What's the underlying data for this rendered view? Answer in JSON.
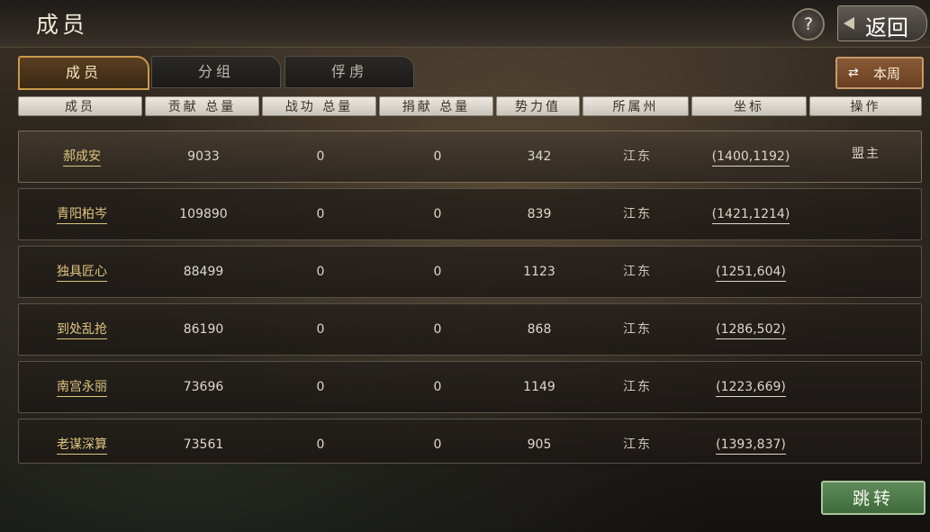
{
  "header": {
    "title": "成员",
    "help_icon_text": "?",
    "back_label": "返回"
  },
  "tabs": [
    {
      "label": "成员",
      "active": true
    },
    {
      "label": "分组",
      "active": false
    },
    {
      "label": "俘虏",
      "active": false
    }
  ],
  "period_toggle": {
    "label": "本周",
    "icon": "swap-arrows-icon"
  },
  "columns": [
    "成员",
    "贡献 总量",
    "战功 总量",
    "捐献 总量",
    "势力值",
    "所属州",
    "坐标",
    "操作"
  ],
  "rows": [
    {
      "name": "郝成安",
      "contribution": "9033",
      "merit": "0",
      "donation": "0",
      "power": "342",
      "state": "江东",
      "coord": "(1400,1192)",
      "op": "盟主"
    },
    {
      "name": "青阳柏岑",
      "contribution": "109890",
      "merit": "0",
      "donation": "0",
      "power": "839",
      "state": "江东",
      "coord": "(1421,1214)",
      "op": ""
    },
    {
      "name": "独具匠心",
      "contribution": "88499",
      "merit": "0",
      "donation": "0",
      "power": "1123",
      "state": "江东",
      "coord": "(1251,604)",
      "op": ""
    },
    {
      "name": "到处乱抢",
      "contribution": "86190",
      "merit": "0",
      "donation": "0",
      "power": "868",
      "state": "江东",
      "coord": "(1286,502)",
      "op": ""
    },
    {
      "name": "南宫永丽",
      "contribution": "73696",
      "merit": "0",
      "donation": "0",
      "power": "1149",
      "state": "江东",
      "coord": "(1223,669)",
      "op": ""
    },
    {
      "name": "老谋深算",
      "contribution": "73561",
      "merit": "0",
      "donation": "0",
      "power": "905",
      "state": "江东",
      "coord": "(1393,837)",
      "op": ""
    }
  ],
  "footer": {
    "jump_label": "跳转"
  },
  "colors": {
    "accent_gold": "#e0c57e",
    "active_tab_border": "#c99a4a",
    "jump_green": "#4f7a4c",
    "week_brown": "#7a4c2c"
  }
}
